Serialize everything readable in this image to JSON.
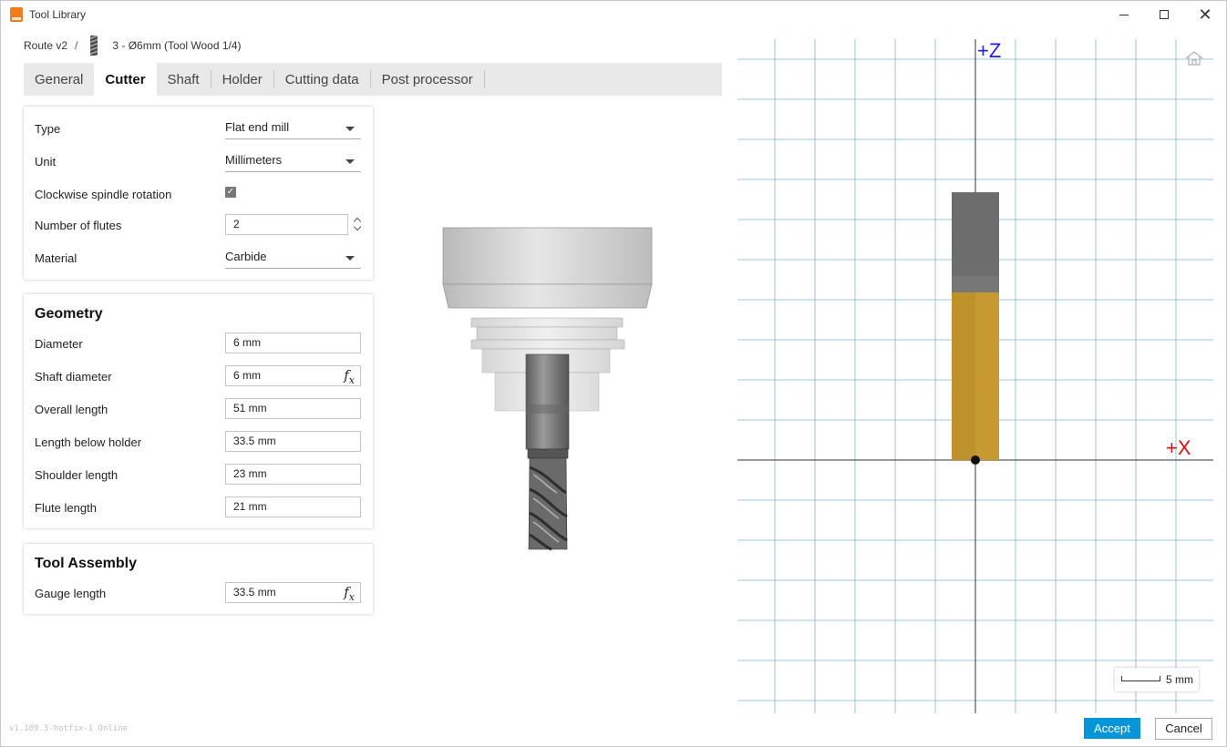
{
  "window": {
    "title": "Tool Library"
  },
  "breadcrumb": {
    "library": "Route v2",
    "separator": "/",
    "tool": "3 - Ø6mm (Tool Wood 1/4)"
  },
  "tabs": [
    {
      "label": "General",
      "active": false
    },
    {
      "label": "Cutter",
      "active": true
    },
    {
      "label": "Shaft",
      "active": false
    },
    {
      "label": "Holder",
      "active": false
    },
    {
      "label": "Cutting data",
      "active": false
    },
    {
      "label": "Post processor",
      "active": false
    }
  ],
  "cutter": {
    "type_label": "Type",
    "type_value": "Flat end mill",
    "unit_label": "Unit",
    "unit_value": "Millimeters",
    "cw_label": "Clockwise spindle rotation",
    "cw_checked": true,
    "flutes_label": "Number of flutes",
    "flutes_value": "2",
    "material_label": "Material",
    "material_value": "Carbide"
  },
  "geometry": {
    "title": "Geometry",
    "fields": [
      {
        "label": "Diameter",
        "value": "6 mm",
        "fx": false
      },
      {
        "label": "Shaft diameter",
        "value": "6 mm",
        "fx": true
      },
      {
        "label": "Overall length",
        "value": "51 mm",
        "fx": false
      },
      {
        "label": "Length below holder",
        "value": "33.5 mm",
        "fx": false
      },
      {
        "label": "Shoulder length",
        "value": "23 mm",
        "fx": false
      },
      {
        "label": "Flute length",
        "value": "21 mm",
        "fx": false
      }
    ]
  },
  "assembly": {
    "title": "Tool Assembly",
    "gauge_label": "Gauge length",
    "gauge_value": "33.5 mm"
  },
  "fx_symbol": {
    "f": "f",
    "x": "x"
  },
  "viewport": {
    "z_axis": "+Z",
    "x_axis": "+X",
    "scale": "5 mm",
    "colors": {
      "grid": "#5b9bb5",
      "z_axis": "#1a1aff",
      "x_axis": "#e01010",
      "shaft": "#6d6d6d",
      "flute": "#c69a30"
    }
  },
  "footer": {
    "version": "v1.109.3-hotfix-1 Online",
    "accept": "Accept",
    "cancel": "Cancel"
  }
}
